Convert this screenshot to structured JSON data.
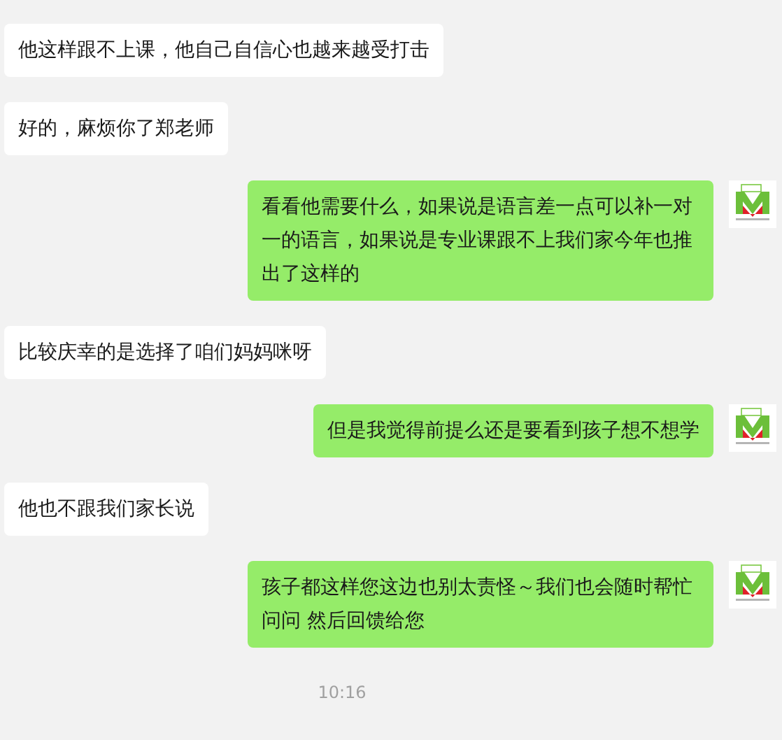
{
  "messages": [
    {
      "kind": "received",
      "text": "他这样跟不上课，他自己自信心也越来越受打击"
    },
    {
      "kind": "received",
      "text": "好的，麻烦你了郑老师"
    },
    {
      "kind": "sent",
      "text": "看看他需要什么，如果说是语言差一点可以补一对一的语言，如果说是专业课跟不上我们家今年也推出了这样的"
    },
    {
      "kind": "received",
      "text": "比较庆幸的是选择了咱们妈妈咪呀"
    },
    {
      "kind": "sent",
      "text": "但是我觉得前提么还是要看到孩子想不想学"
    },
    {
      "kind": "received",
      "text": "他也不跟我们家长说"
    },
    {
      "kind": "sent",
      "text": "孩子都这样您这边也别太责怪～我们也会随时帮忙问问 然后回馈给您"
    }
  ],
  "timestamp": "10:16"
}
